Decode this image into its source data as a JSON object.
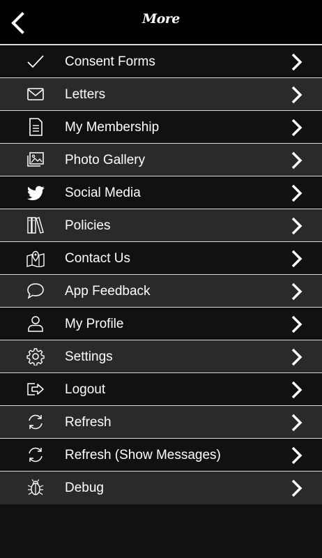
{
  "header": {
    "title": "More",
    "back_icon": "chevron-left-icon"
  },
  "colors": {
    "background": "#111111",
    "row_alt": "#2a2a2a",
    "header": "#000000",
    "divider": "#d9d9d9",
    "text": "#ffffff"
  },
  "menu": {
    "items": [
      {
        "label": "Consent Forms",
        "icon": "checkmark-icon"
      },
      {
        "label": "Letters",
        "icon": "envelope-icon"
      },
      {
        "label": "My Membership",
        "icon": "document-icon"
      },
      {
        "label": "Photo Gallery",
        "icon": "photo-gallery-icon"
      },
      {
        "label": "Social Media",
        "icon": "twitter-bird-icon"
      },
      {
        "label": "Policies",
        "icon": "books-icon"
      },
      {
        "label": "Contact Us",
        "icon": "map-pin-icon"
      },
      {
        "label": "App Feedback",
        "icon": "speech-bubble-icon"
      },
      {
        "label": "My Profile",
        "icon": "person-icon"
      },
      {
        "label": "Settings",
        "icon": "gear-icon"
      },
      {
        "label": "Logout",
        "icon": "logout-icon"
      },
      {
        "label": "Refresh",
        "icon": "refresh-icon"
      },
      {
        "label": "Refresh (Show Messages)",
        "icon": "refresh-icon"
      },
      {
        "label": "Debug",
        "icon": "bug-icon"
      }
    ]
  }
}
